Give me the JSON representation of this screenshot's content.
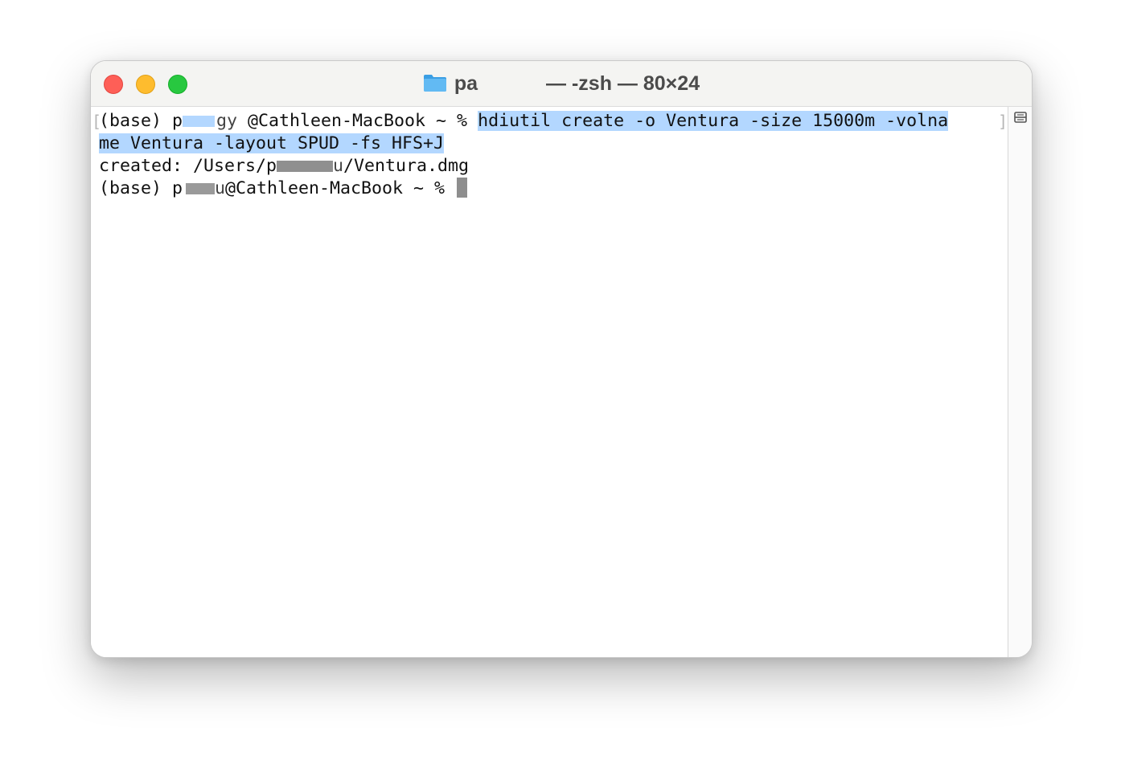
{
  "window": {
    "title_user_visible": "pa",
    "title_rest": " — -zsh — 80×24",
    "folder_icon": "folder-icon",
    "controls": {
      "close": "close-button",
      "minimize": "minimize-button",
      "maximize": "zoom-button"
    },
    "colors": {
      "close": "#fe5f57",
      "minimize": "#febc2e",
      "maximize": "#28c840",
      "selection": "#b3d7ff",
      "cursor": "#8e8e8e"
    }
  },
  "terminal": {
    "line1": {
      "prefix": "(base) ",
      "user_partial": "p",
      "user_tail": "gy",
      "host_prompt": " @Cathleen-MacBook ~ % ",
      "command_part1": "hdiutil create -o Ventura -size 15000m -volna"
    },
    "line2": {
      "command_part2": "me Ventura -layout SPUD -fs HFS+J"
    },
    "line3": {
      "prefix": "created: /Users/",
      "user_partial": "p",
      "user_tail": "u",
      "suffix": "/Ventura.dmg"
    },
    "line4": {
      "prefix": "(base) ",
      "user_partial": "p",
      "user_tail": "u",
      "host_prompt": "@Cathleen-MacBook ~ % "
    },
    "rows": 24,
    "cols": 80,
    "split_icon": "split-pane-icon"
  }
}
